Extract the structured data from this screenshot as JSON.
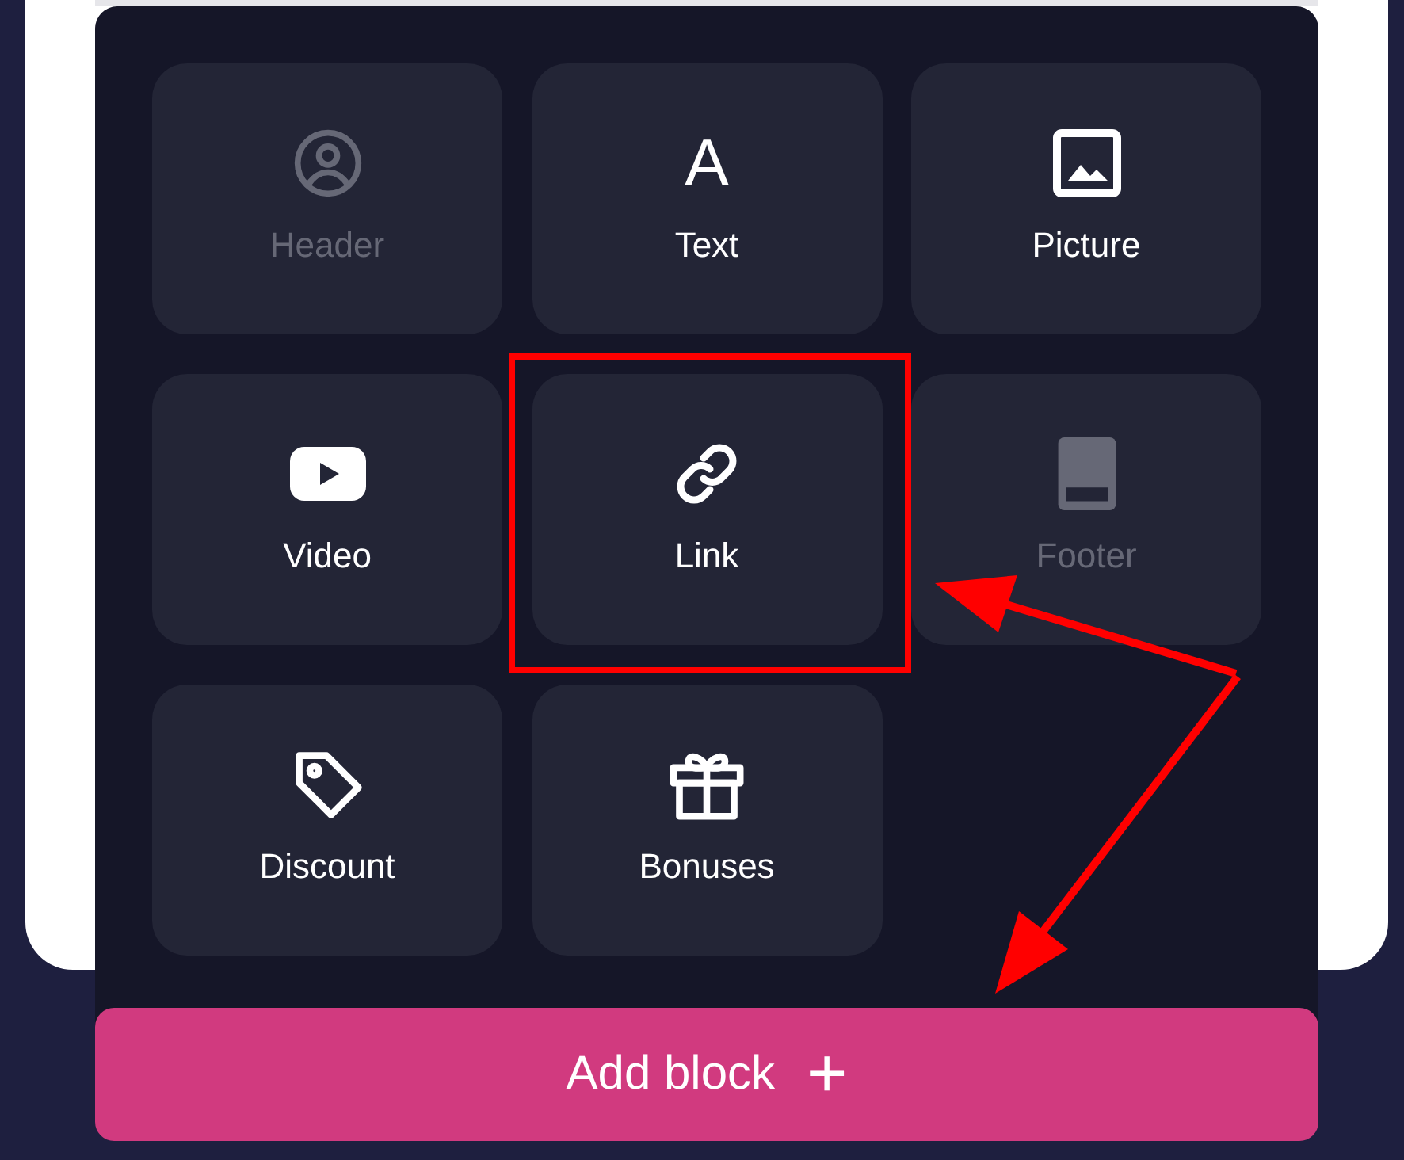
{
  "blocks": [
    {
      "label": "Header",
      "kind": "person",
      "disabled": true
    },
    {
      "label": "Text",
      "kind": "glyph",
      "glyph": "A",
      "disabled": false
    },
    {
      "label": "Picture",
      "kind": "image",
      "disabled": false
    },
    {
      "label": "Video",
      "kind": "play",
      "disabled": false
    },
    {
      "label": "Link",
      "kind": "link",
      "disabled": false
    },
    {
      "label": "Footer",
      "kind": "footer",
      "disabled": true
    },
    {
      "label": "Discount",
      "kind": "tag",
      "disabled": false
    },
    {
      "label": "Bonuses",
      "kind": "gift",
      "disabled": false
    }
  ],
  "add_button": {
    "label": "Add block",
    "icon": "+"
  }
}
